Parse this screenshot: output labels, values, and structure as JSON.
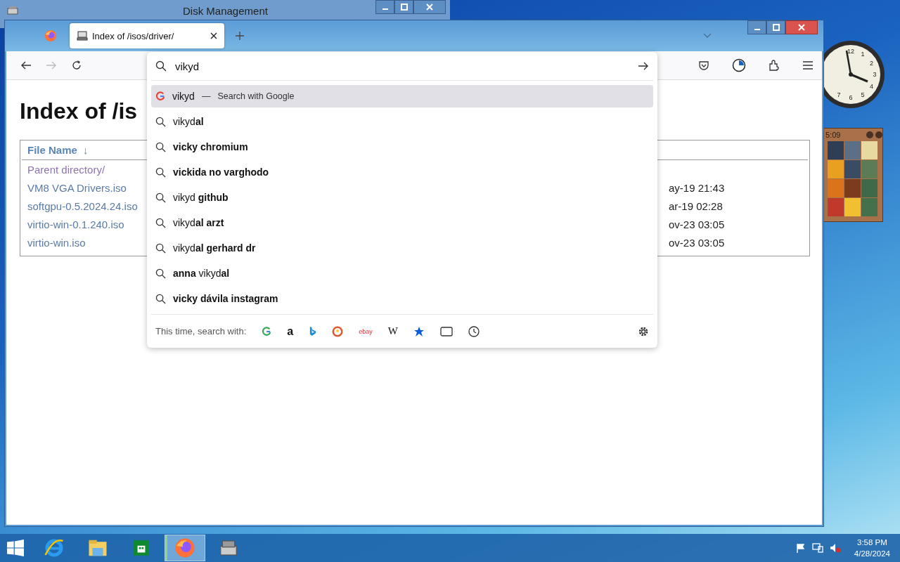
{
  "background_window": {
    "title": "Disk Management"
  },
  "browser": {
    "tabs": [
      {
        "title": "Index of /isos/driver/",
        "selected": true
      }
    ],
    "back": {
      "disabled": false
    },
    "forward": {
      "disabled": true
    },
    "url_value": "vikyd",
    "suggestions": [
      {
        "kind": "engine",
        "text": "vikyd",
        "separator": "—",
        "hint": "Search with Google",
        "selected": true
      },
      {
        "kind": "search",
        "text": "vikyd**al**",
        "selected": false
      },
      {
        "kind": "search",
        "text": "**vicky chromium**",
        "selected": false
      },
      {
        "kind": "search",
        "text": "**vickida no varghodo**",
        "selected": false
      },
      {
        "kind": "search",
        "text": "vikyd **github**",
        "selected": false
      },
      {
        "kind": "search",
        "text": "vikyd**al arzt**",
        "selected": false
      },
      {
        "kind": "search",
        "text": "vikyd**al gerhard dr**",
        "selected": false
      },
      {
        "kind": "search",
        "text": "**anna** vikyd**al**",
        "selected": false
      },
      {
        "kind": "search",
        "text": "**vicky dávila instagram**",
        "selected": false
      }
    ],
    "footer_label": "This time, search with:",
    "engines": [
      {
        "kind": "google"
      },
      {
        "kind": "amazon",
        "label": "a"
      },
      {
        "kind": "bing"
      },
      {
        "kind": "duckduckgo"
      },
      {
        "kind": "ebay",
        "label": "ebay"
      },
      {
        "kind": "wikipedia",
        "label": "W"
      },
      {
        "kind": "bookmarks"
      },
      {
        "kind": "tabs"
      },
      {
        "kind": "history"
      }
    ],
    "page": {
      "heading": "Index of /is",
      "table": {
        "header": "File Name",
        "sort_arrow": "↓",
        "rows": [
          {
            "name": "Parent directory/",
            "visited": true
          },
          {
            "name": "VM8 VGA Drivers.iso",
            "visited": false,
            "column_3": "ay-19 21:43"
          },
          {
            "name": "softgpu-0.5.2024.24.iso",
            "visited": false,
            "column_3": "ar-19 02:28"
          },
          {
            "name": "virtio-win-0.1.240.iso",
            "visited": false,
            "column_3": "ov-23 03:05"
          },
          {
            "name": "virtio-win.iso",
            "visited": false,
            "column_3": "ov-23 03:05"
          }
        ]
      }
    }
  },
  "clock_gadget": {
    "numerals": [
      "12",
      "1",
      "2",
      "3",
      "4",
      "5",
      "6",
      "7"
    ]
  },
  "puzzle_gadget": {
    "time": "5:09"
  },
  "taskbar": {
    "apps": [
      {
        "kind": "start",
        "selected": false
      },
      {
        "kind": "ie",
        "selected": false
      },
      {
        "kind": "explorer",
        "selected": false
      },
      {
        "kind": "store",
        "selected": false
      },
      {
        "kind": "firefox",
        "selected": true
      },
      {
        "kind": "disk",
        "selected": false
      }
    ],
    "time": "3:58 PM",
    "date": "4/28/2024"
  }
}
